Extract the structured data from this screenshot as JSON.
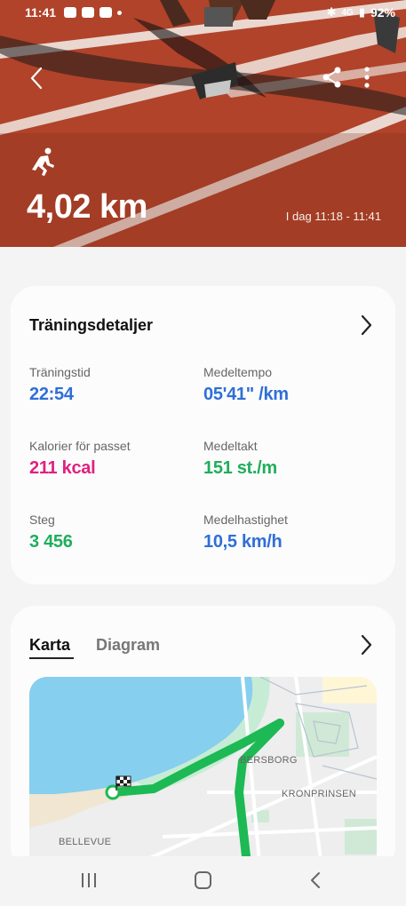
{
  "status_bar": {
    "time": "11:41",
    "network": "4G",
    "battery": "92%"
  },
  "header": {
    "distance": "4,02 km",
    "time_range": "I dag 11:18 - 11:41",
    "icons": [
      "back-icon",
      "share-icon",
      "more-icon",
      "running-icon"
    ]
  },
  "details": {
    "title": "Träningsdetaljer",
    "stats": [
      {
        "label": "Träningstid",
        "value": "22:54",
        "color": "#2f6fd6"
      },
      {
        "label": "Medeltempo",
        "value": "05'41\" /km",
        "color": "#2f6fd6"
      },
      {
        "label": "Kalorier för passet",
        "value": "211 kcal",
        "color": "#e0207f"
      },
      {
        "label": "Medeltakt",
        "value": "151 st./m",
        "color": "#1fae5b"
      },
      {
        "label": "Steg",
        "value": "3 456",
        "color": "#1fae5b"
      },
      {
        "label": "Medelhastighet",
        "value": "10,5 km/h",
        "color": "#2f6fd6"
      }
    ]
  },
  "map_card": {
    "tabs": [
      {
        "label": "Karta",
        "active": true
      },
      {
        "label": "Diagram",
        "active": false
      }
    ],
    "map_labels": [
      "BERSBORG",
      "KRONPRINSEN",
      "BELLEVUE"
    ],
    "route_color": "#1db954"
  },
  "nav_bar": {
    "icons": [
      "recents-icon",
      "home-icon",
      "back-nav-icon"
    ]
  }
}
